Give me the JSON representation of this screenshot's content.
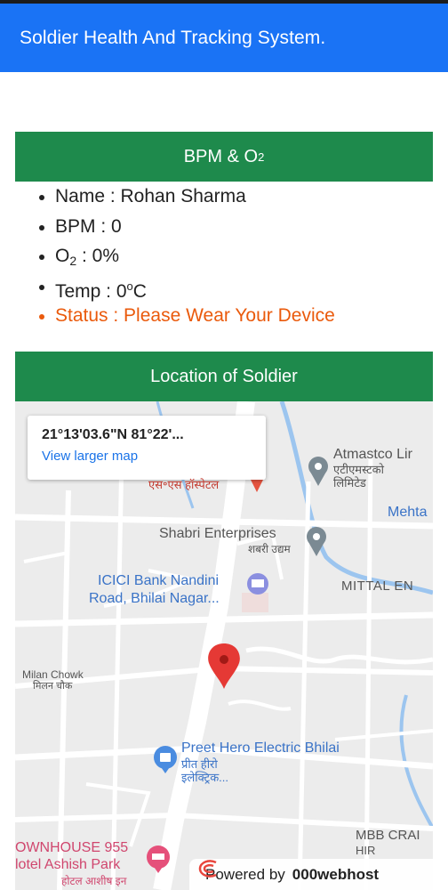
{
  "app": {
    "title": "Soldier Health And Tracking System."
  },
  "vitals": {
    "header_main": "BPM & O",
    "header_sub": "2",
    "name": "Name : Rohan Sharma",
    "bpm": "BPM : 0",
    "o2_main": "O",
    "o2_sub": "2",
    "o2_value": " : 0%",
    "temp_label": "Temp : 0",
    "temp_unit_sup": "o",
    "temp_unit": "C",
    "status": "Status : Please Wear Your Device",
    "status_color": "#ea5a0c"
  },
  "location": {
    "header": "Location of Soldier",
    "map": {
      "coordinates": "21°13'03.6\"N 81°22'...",
      "view_larger": "View larger map",
      "labels": {
        "hospital": "एस॰एस हॉस्पेटल",
        "atmastco_en": "Atmastco Lir",
        "atmastco_hi": "एटीएमस्टको",
        "atmastco_hi2": "लिमिटेड",
        "mehta": "Mehta",
        "shabri_en": "Shabri Enterprises",
        "shabri_hi": "शबरी उद्यम",
        "icici_1": "ICICI Bank Nandini",
        "icici_2": "Road, Bhilai Nagar...",
        "mittal": "MITTAL EN",
        "milan_en": "Milan Chowk",
        "milan_hi": "मिलन चौक",
        "preet_en": "Preet Hero Electric Bhilai",
        "preet_hi": "प्रीत हीरो",
        "preet_hi2": "इलेक्ट्रिक...",
        "townhouse": "OWNHOUSE 955",
        "ashish_en": "lotel Ashish Park",
        "ashish_hi": "होटल आशीष इन",
        "mbb": "MBB CRAI",
        "hir": "HIR"
      },
      "icons": [
        "location-pin-icon",
        "hospital-pin-icon",
        "place-pin-icon",
        "bank-icon",
        "shopping-bag-icon",
        "hotel-icon"
      ]
    },
    "powered_by": "Powered by",
    "host": "000webhost"
  },
  "colors": {
    "appbar": "#1a73f5",
    "card_header": "#1e8a4c",
    "map_bg": "#ececec",
    "pin_red": "#e53935"
  }
}
